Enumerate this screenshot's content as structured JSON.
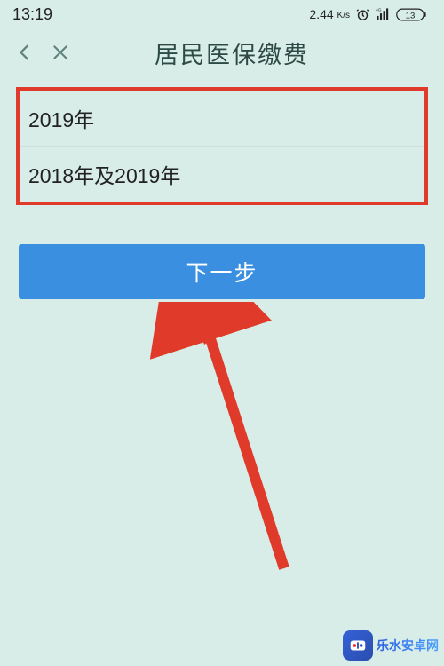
{
  "status": {
    "time": "13:19",
    "net_speed_value": "2.44",
    "net_speed_unit": "K/s",
    "battery_text": "13"
  },
  "nav": {
    "title": "居民医保缴费"
  },
  "options": {
    "items": [
      {
        "label": "2019年"
      },
      {
        "label": "2018年及2019年"
      }
    ]
  },
  "action": {
    "next_label": "下一步"
  },
  "watermark": {
    "text": "乐水安卓网"
  }
}
